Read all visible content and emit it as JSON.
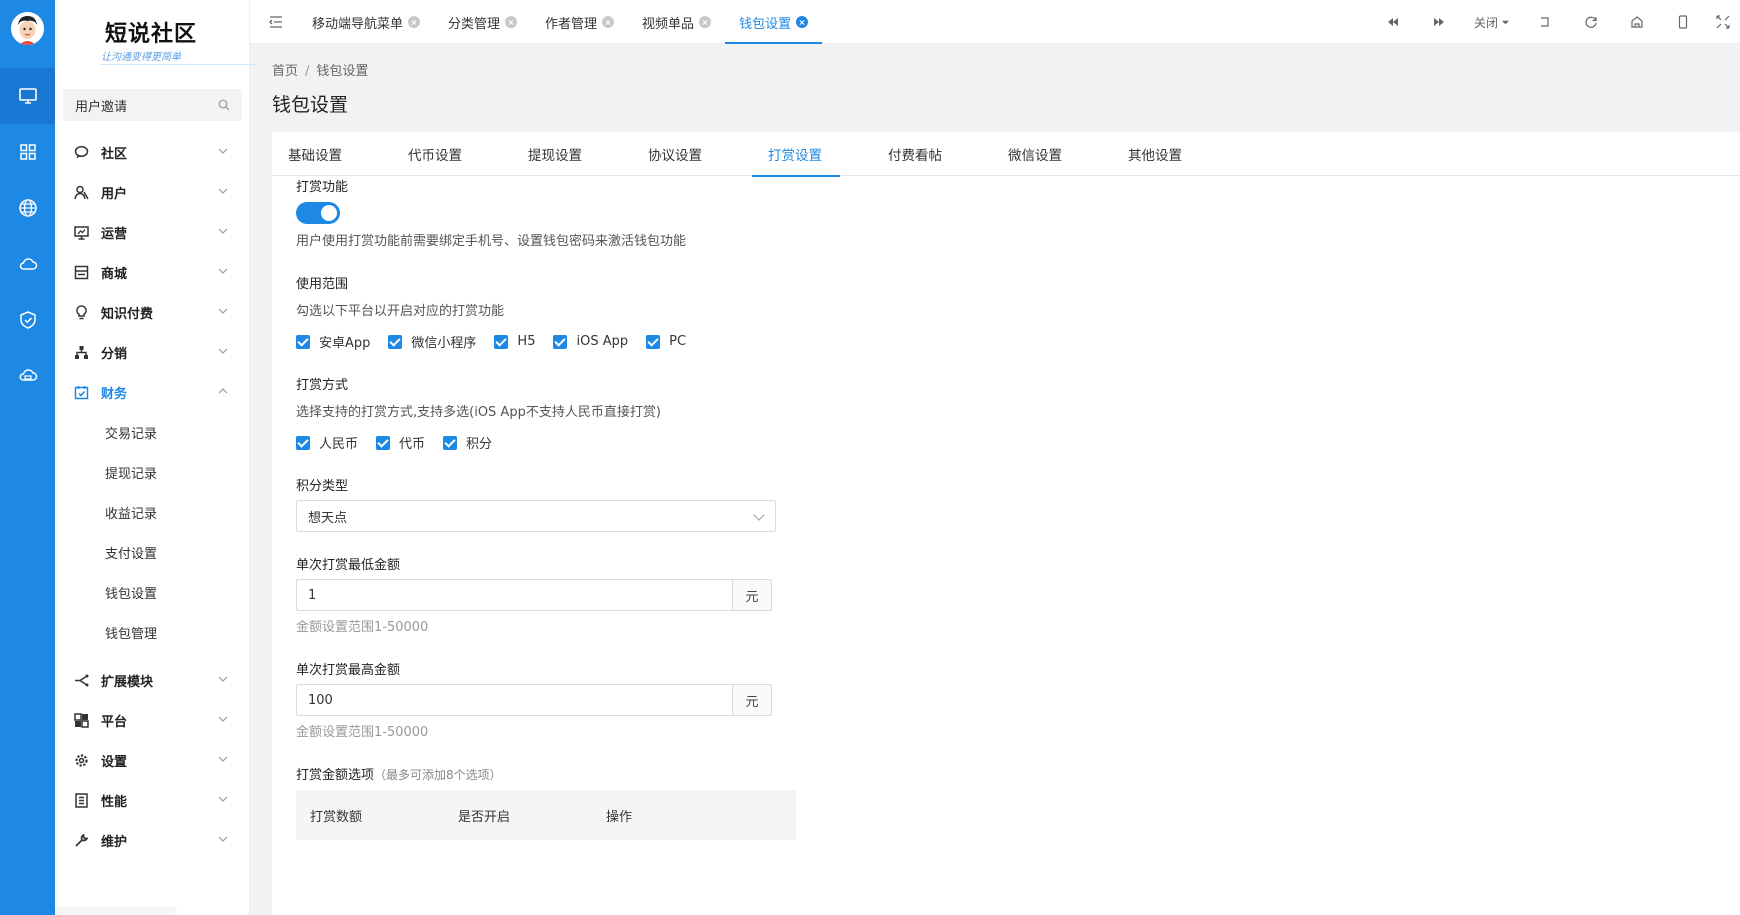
{
  "brand": {
    "title": "短说社区",
    "subtitle": "让沟通变得更简单"
  },
  "rail": {
    "icons": [
      "monitor-icon",
      "apps-grid-icon",
      "globe-icon",
      "cloud-icon",
      "shield-icon",
      "cloud-service-icon"
    ]
  },
  "sidebar": {
    "search_text": "用户邀请",
    "items": [
      {
        "label": "社区",
        "icon": "chat-icon"
      },
      {
        "label": "用户",
        "icon": "user-icon"
      },
      {
        "label": "运营",
        "icon": "presentation-icon"
      },
      {
        "label": "商城",
        "icon": "store-icon"
      },
      {
        "label": "知识付费",
        "icon": "bulb-icon"
      },
      {
        "label": "分销",
        "icon": "hierarchy-icon"
      },
      {
        "label": "财务",
        "icon": "calendar-icon"
      }
    ],
    "finance_sub": [
      "交易记录",
      "提现记录",
      "收益记录",
      "支付设置",
      "钱包设置",
      "钱包管理"
    ],
    "items_after": [
      {
        "label": "扩展模块",
        "icon": "share-icon"
      },
      {
        "label": "平台",
        "icon": "platform-icon"
      },
      {
        "label": "设置",
        "icon": "gear-icon"
      },
      {
        "label": "性能",
        "icon": "performance-icon"
      },
      {
        "label": "维护",
        "icon": "wrench-icon"
      }
    ]
  },
  "topbar": {
    "tabs": [
      "移动端导航菜单",
      "分类管理",
      "作者管理",
      "视频单品",
      "钱包设置"
    ],
    "active_tab": "钱包设置",
    "close_label": "关闭"
  },
  "breadcrumb": {
    "home": "首页",
    "separator": "/",
    "current": "钱包设置"
  },
  "page_title": "钱包设置",
  "subtabs": [
    "基础设置",
    "代币设置",
    "提现设置",
    "协议设置",
    "打赏设置",
    "付费看帖",
    "微信设置",
    "其他设置"
  ],
  "active_subtab": "打赏设置",
  "form": {
    "reward_label": "打赏功能",
    "reward_enabled": true,
    "reward_help": "用户使用打赏功能前需要绑定手机号、设置钱包密码来激活钱包功能",
    "scope_label": "使用范围",
    "scope_help": "勾选以下平台以开启对应的打赏功能",
    "scope_options": [
      "安卓App",
      "微信小程序",
      "H5",
      "iOS App",
      "PC"
    ],
    "method_label": "打赏方式",
    "method_help": "选择支持的打赏方式,支持多选(iOS App不支持人民币直接打赏)",
    "method_options": [
      "人民币",
      "代币",
      "积分"
    ],
    "points_type_label": "积分类型",
    "points_type_value": "想天点",
    "min_label": "单次打赏最低金额",
    "min_value": "1",
    "min_unit": "元",
    "min_hint": "金额设置范围1-50000",
    "max_label": "单次打赏最高金额",
    "max_value": "100",
    "max_unit": "元",
    "max_hint": "金额设置范围1-50000",
    "options_label": "打赏金额选项",
    "options_note": "（最多可添加8个选项）",
    "table_headers": [
      "打赏数额",
      "是否开启",
      "操作"
    ]
  },
  "colors": {
    "accent": "#1e88e5",
    "rail": "#1e88e5"
  }
}
